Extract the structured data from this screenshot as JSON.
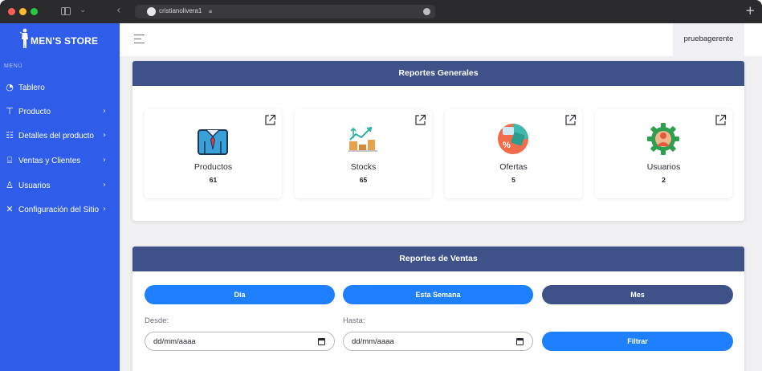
{
  "browser": {
    "url": "cristianolivera1"
  },
  "sidebar": {
    "brand": "MEN'S STORE",
    "menu_label": "MENÚ",
    "items": [
      {
        "label": "Tablero",
        "icon": "dashboard-icon"
      },
      {
        "label": "Producto",
        "icon": "shirt-icon"
      },
      {
        "label": "Detalles del producto",
        "icon": "details-list-icon"
      },
      {
        "label": "Ventas y Clientes",
        "icon": "sales-icon"
      },
      {
        "label": "Usuarios",
        "icon": "user-icon"
      },
      {
        "label": "Configuración del Sitio",
        "icon": "tools-icon"
      }
    ],
    "chevron": "›"
  },
  "topbar": {
    "user": "pruebagerente"
  },
  "general": {
    "title": "Reportes Generales",
    "stats": [
      {
        "label": "Productos",
        "value": "61",
        "icon": "shirt-illustration-icon"
      },
      {
        "label": "Stocks",
        "value": "65",
        "icon": "stock-chart-icon"
      },
      {
        "label": "Ofertas",
        "value": "5",
        "icon": "discount-tag-icon"
      },
      {
        "label": "Usuarios",
        "value": "2",
        "icon": "user-gear-icon"
      }
    ]
  },
  "sales": {
    "title": "Reportes de Ventas",
    "buttons": {
      "day": "Día",
      "week": "Esta Semana",
      "month": "Mes",
      "filter": "Filtrar"
    },
    "from_label": "Desde:",
    "to_label": "Hasta:",
    "from_value": "dd/mm/aaaa",
    "to_value": "dd/mm/aaaa"
  },
  "colors": {
    "sidebar": "#2f5ce9",
    "header": "#3e5289",
    "primary_button": "#1f80ff"
  }
}
